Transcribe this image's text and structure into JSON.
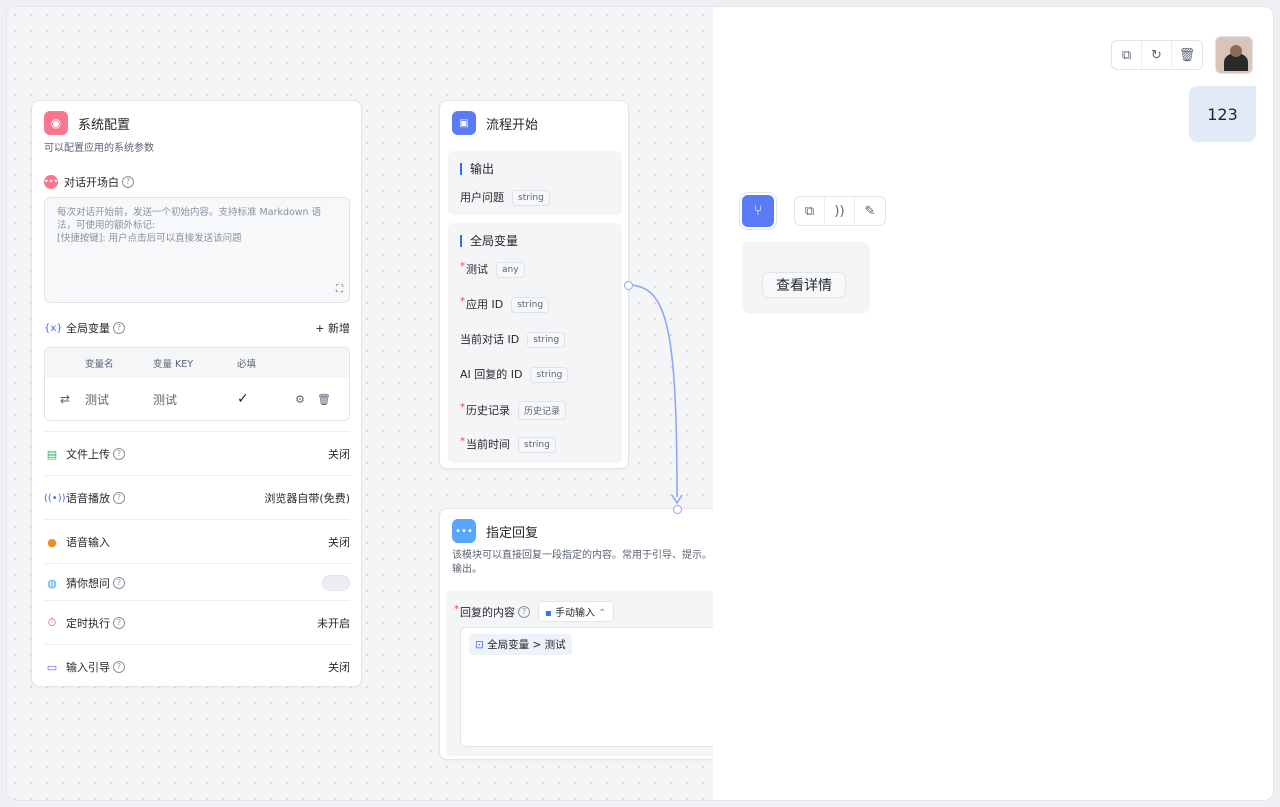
{
  "system_config": {
    "title": "系统配置",
    "desc": "可以配置应用的系统参数",
    "opener": {
      "label": "对话开场白",
      "placeholder_line1": "每次对话开始前，发送一个初始内容。支持标准 Markdown 语",
      "placeholder_line2": "法，可使用的额外标记:",
      "placeholder_line3": "[快捷按键]: 用户点击后可以直接发送该问题"
    },
    "global_vars": {
      "label": "全局变量",
      "add_label": "+ 新增",
      "headers": [
        "变量名",
        "变量 KEY",
        "必填"
      ],
      "rows": [
        {
          "name": "测试",
          "key": "测试",
          "required": "✓"
        }
      ]
    },
    "settings": [
      {
        "label": "文件上传",
        "value": "关闭",
        "icon": "file-upload-icon",
        "color": "#36ad6a"
      },
      {
        "label": "语音播放",
        "value": "浏览器自带(免费)",
        "icon": "voice-play-icon",
        "color": "#3370ff"
      },
      {
        "label": "语音输入",
        "value": "关闭",
        "icon": "microphone-icon",
        "color": "#f08a24"
      },
      {
        "label": "猜你想问",
        "value": "",
        "icon": "lightbulb-icon",
        "color": "#36a3f7"
      },
      {
        "label": "定时执行",
        "value": "未开启",
        "icon": "timer-icon",
        "color": "#e5484d"
      },
      {
        "label": "输入引导",
        "value": "关闭",
        "icon": "input-guide-icon",
        "color": "#6b5cf6"
      }
    ]
  },
  "flow_start": {
    "title": "流程开始",
    "output": {
      "title": "输出",
      "vars": [
        {
          "name": "用户问题",
          "type": "string"
        }
      ]
    },
    "global": {
      "title": "全局变量",
      "vars": [
        {
          "name": "测试",
          "type": "any",
          "required": true
        },
        {
          "name": "应用 ID",
          "type": "string",
          "required": true
        },
        {
          "name": "当前对话 ID",
          "type": "string",
          "required": false
        },
        {
          "name": "AI 回复的 ID",
          "type": "string",
          "required": false
        },
        {
          "name": "历史记录",
          "type": "历史记录",
          "required": true
        },
        {
          "name": "当前时间",
          "type": "string",
          "required": true
        }
      ]
    }
  },
  "reply_node": {
    "title": "指定回复",
    "desc_line1": "该模块可以直接回复一段指定的内容。常用于引导、提示。",
    "desc_line2": "输出。",
    "content_label": "回复的内容",
    "mode": "手动输入",
    "ref_chip": "全局变量 > 测试"
  },
  "chat": {
    "user_message": "123",
    "view_details": "查看详情"
  },
  "colors": {
    "accent": "#3370ff",
    "connector": "#8fa7f5"
  }
}
